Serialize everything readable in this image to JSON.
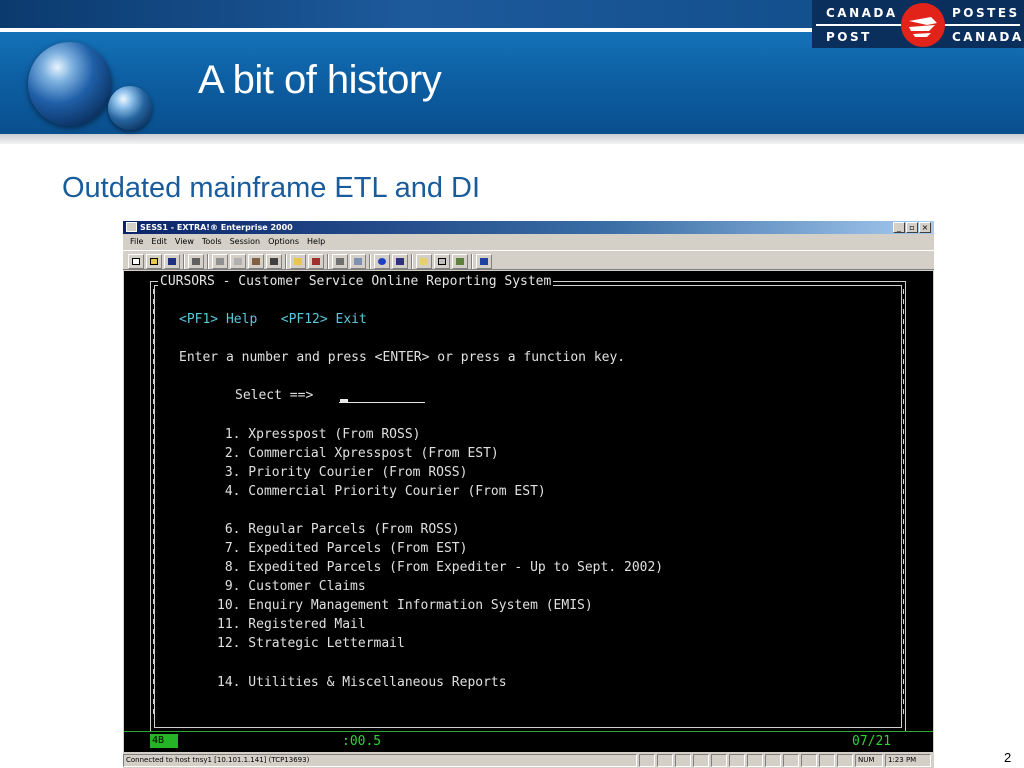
{
  "slide": {
    "title": "A bit of history",
    "subtitle": "Outdated mainframe ETL and DI",
    "page_number": "2",
    "logo": {
      "line1_left": "CANADA",
      "line1_right": "POSTES",
      "line2_left": "POST",
      "line2_right": "CANADA",
      "colors": {
        "navy": "#0b2f5c",
        "red": "#e2231a"
      }
    }
  },
  "window": {
    "title": "SESS1 - EXTRA!® Enterprise 2000",
    "controls": [
      "_",
      "▫",
      "×"
    ],
    "menu": [
      "File",
      "Edit",
      "View",
      "Tools",
      "Session",
      "Options",
      "Help"
    ],
    "toolbar_icons": [
      "new-icon",
      "open-icon",
      "save-icon",
      "print-icon",
      "cut-icon",
      "copy-icon",
      "paste-icon",
      "glasses-icon",
      "folder-icon",
      "macro-icon",
      "print-screen-icon",
      "send-icon",
      "dot-icon",
      "record-icon",
      "edit-icon",
      "display-icon",
      "check-icon",
      "help-icon"
    ]
  },
  "terminal": {
    "screen_title": "CURSORS - Customer Service Online Reporting System",
    "function_keys": "<PF1> Help   <PF12> Exit",
    "instruction": "Enter a number and press <ENTER> or press a function key.",
    "select_prompt": "Select ==>",
    "menu_options": [
      " 1. Xpresspost (From ROSS)",
      " 2. Commercial Xpresspost (From EST)",
      " 3. Priority Courier (From ROSS)",
      " 4. Commercial Priority Courier (From EST)",
      " 6. Regular Parcels (From ROSS)",
      " 7. Expedited Parcels (From EST)",
      " 8. Expedited Parcels (From Expediter - Up to Sept. 2002)",
      " 9. Customer Claims",
      "10. Enquiry Management Information System (EMIS)",
      "11. Registered Mail",
      "12. Strategic Lettermail",
      "14. Utilities & Miscellaneous Reports"
    ],
    "oia_indicator": "4B",
    "oia_timer": ":00.5",
    "cursor_position": "07/21"
  },
  "statusbar": {
    "connection": "Connected to host tnsy1 [10.101.1.141] (TCP13693)",
    "num": "NUM",
    "time": "1:23 PM"
  }
}
